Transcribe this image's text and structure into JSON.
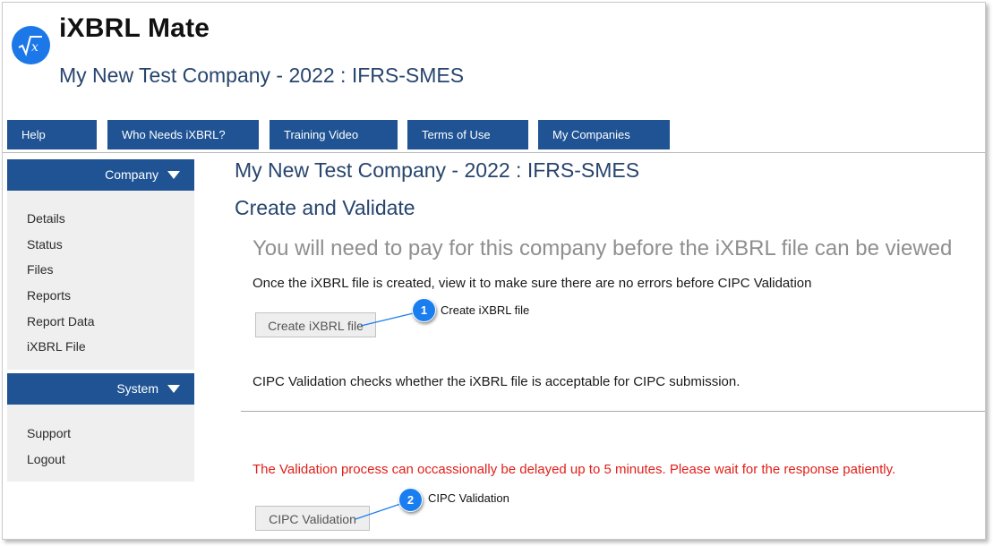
{
  "header": {
    "app_title": "iXBRL Mate",
    "company_subtitle": "My New Test Company - 2022 : IFRS-SMES",
    "logo_icon": "sqrt-x-icon"
  },
  "topnav": {
    "items": [
      {
        "label": "Help"
      },
      {
        "label": "Who Needs iXBRL?"
      },
      {
        "label": "Training Video"
      },
      {
        "label": "Terms of Use"
      },
      {
        "label": "My Companies"
      }
    ]
  },
  "sidebar": {
    "company_header": "Company",
    "company_items": [
      {
        "label": "Details"
      },
      {
        "label": "Status"
      },
      {
        "label": "Files"
      },
      {
        "label": "Reports"
      },
      {
        "label": "Report Data"
      },
      {
        "label": "iXBRL File"
      }
    ],
    "system_header": "System",
    "system_items": [
      {
        "label": "Support"
      },
      {
        "label": "Logout"
      }
    ]
  },
  "main": {
    "title": "My New Test Company - 2022 : IFRS-SMES",
    "subtitle": "Create and Validate",
    "payment_warning": "You will need to pay for this company before the iXBRL file can be viewed",
    "create_info": "Once the iXBRL file is created, view it to make sure there are no errors before CIPC Validation",
    "create_button": "Create iXBRL file",
    "cipc_info": "CIPC Validation checks whether the iXBRL file is acceptable for CIPC submission.",
    "delay_warning": "The Validation process can occassionally be delayed up to 5 minutes. Please wait for the response patiently.",
    "cipc_button": "CIPC Validation"
  },
  "callouts": [
    {
      "number": "1",
      "label": "Create iXBRL file"
    },
    {
      "number": "2",
      "label": "CIPC Validation"
    }
  ],
  "colors": {
    "nav_blue": "#1f5394",
    "heading_blue": "#27456d",
    "warning_red": "#e0201a",
    "callout_blue": "#1b7ef0",
    "sidebar_bg": "#efefef"
  }
}
